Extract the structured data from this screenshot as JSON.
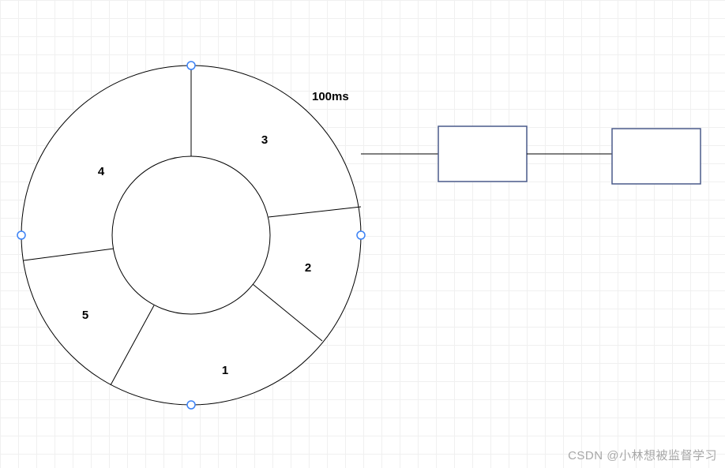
{
  "diagram": {
    "annotation": "100ms",
    "sectors": {
      "s1": "1",
      "s2": "2",
      "s3": "3",
      "s4": "4",
      "s5": "5"
    }
  },
  "watermark": "CSDN @小林想被监督学习"
}
